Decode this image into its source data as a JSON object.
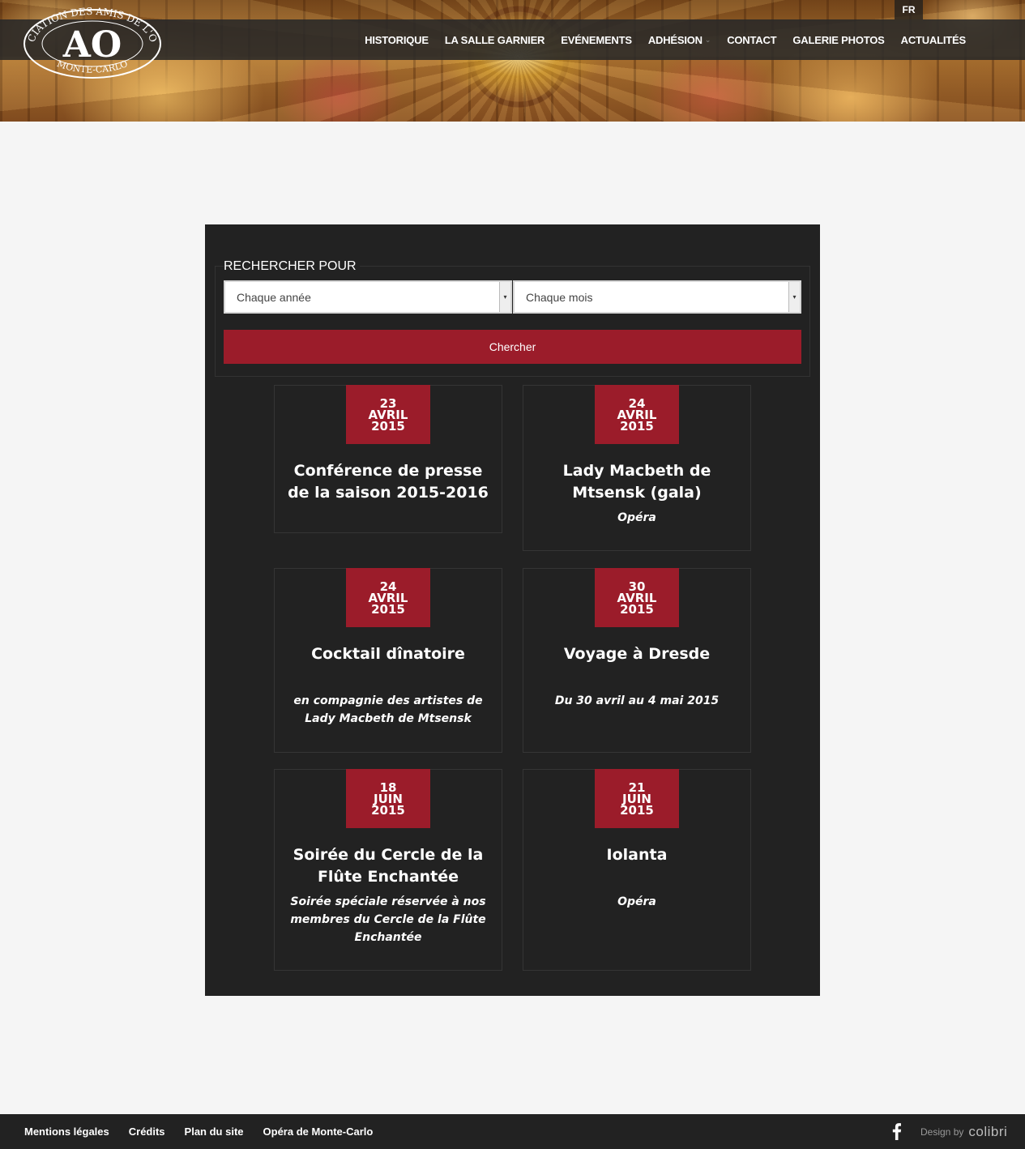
{
  "header": {
    "lang": "FR",
    "logo_top_text": "ASSOCIATION DES AMIS DE L'OPÉRA",
    "logo_bottom_text": "MONTE-CARLO",
    "logo_monogram": "AO",
    "nav": [
      {
        "label": "HISTORIQUE"
      },
      {
        "label": "LA SALLE GARNIER"
      },
      {
        "label": "EVÉNEMENTS"
      },
      {
        "label": "ADHÉSION",
        "icon": "chevron-down-icon"
      },
      {
        "label": "CONTACT"
      },
      {
        "label": "GALERIE PHOTOS"
      },
      {
        "label": "ACTUALITÉS"
      }
    ]
  },
  "search": {
    "legend": "RECHERCHER POUR",
    "year_value": "Chaque année",
    "month_value": "Chaque mois",
    "button": "Chercher"
  },
  "events": [
    {
      "day": "23",
      "month": "AVRIL",
      "year": "2015",
      "title": "Conférence de presse de la saison 2015-2016",
      "subtitle": ""
    },
    {
      "day": "24",
      "month": "AVRIL",
      "year": "2015",
      "title": "Lady Macbeth de Mtsensk (gala)",
      "subtitle": "Opéra"
    },
    {
      "day": "24",
      "month": "AVRIL",
      "year": "2015",
      "title": "Cocktail dînatoire",
      "subtitle": "en compagnie des artistes de Lady Macbeth de Mtsensk"
    },
    {
      "day": "30",
      "month": "AVRIL",
      "year": "2015",
      "title": "Voyage à Dresde",
      "subtitle": "Du 30 avril au 4 mai 2015"
    },
    {
      "day": "18",
      "month": "JUIN",
      "year": "2015",
      "title": "Soirée du Cercle de la Flûte Enchantée",
      "subtitle": "Soirée spéciale réservée à nos membres du Cercle de la Flûte Enchantée"
    },
    {
      "day": "21",
      "month": "JUIN",
      "year": "2015",
      "title": "Iolanta",
      "subtitle": "Opéra"
    }
  ],
  "footer": {
    "links": [
      "Mentions légales",
      "Crédits",
      "Plan du site",
      "Opéra de Monte-Carlo"
    ],
    "design_by": "Design by",
    "brand": "colibri"
  },
  "colors": {
    "accent": "#9b1c2a",
    "panel": "#222222",
    "page_bg": "#f5f5f5"
  }
}
